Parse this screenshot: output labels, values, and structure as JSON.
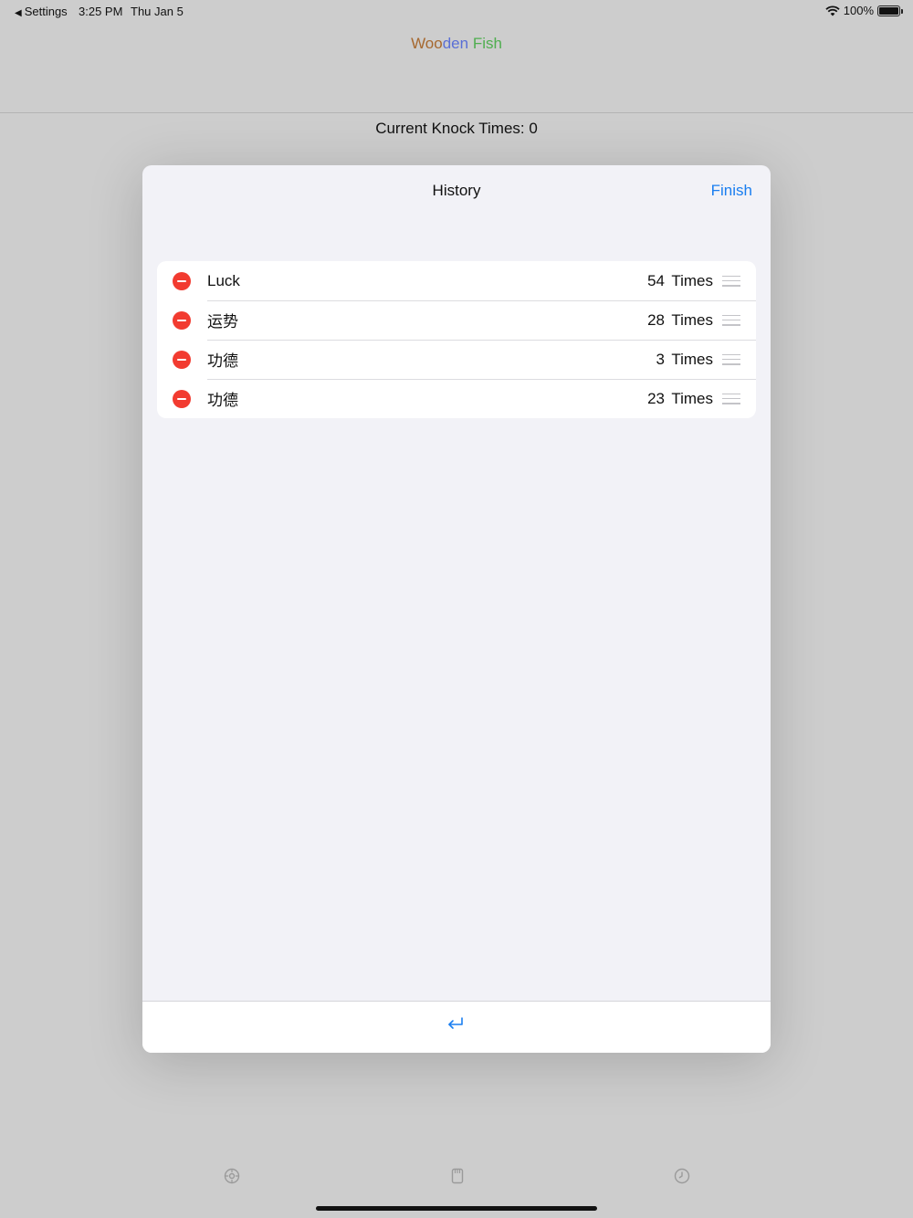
{
  "status_bar": {
    "back_label": "Settings",
    "time": "3:25 PM",
    "date": "Thu Jan 5",
    "battery": "100%",
    "icons": [
      "wifi-icon",
      "battery-icon"
    ]
  },
  "app": {
    "title_part1": "Woo",
    "title_part2": "den",
    "title_part3": " Fish",
    "title_colors": [
      "#a6682f",
      "#5a6fd6",
      "#4fae4f"
    ],
    "knock_label": "Current Knock Times: 0"
  },
  "modal": {
    "title": "History",
    "finish_label": "Finish",
    "items": [
      {
        "name": "Luck",
        "count": "54",
        "unit": "Times"
      },
      {
        "name": "运势",
        "count": "28",
        "unit": "Times"
      },
      {
        "name": "功德",
        "count": "3",
        "unit": "Times"
      },
      {
        "name": "功德",
        "count": "23",
        "unit": "Times"
      }
    ],
    "footer_icon": "return-icon"
  },
  "tab_bar": {
    "icons": [
      "gear-icon",
      "document-icon",
      "clock-icon"
    ]
  },
  "colors": {
    "accent": "#1a7ef0",
    "delete": "#f23b30",
    "background": "#cdcdcd",
    "sheet": "#f2f2f7"
  }
}
